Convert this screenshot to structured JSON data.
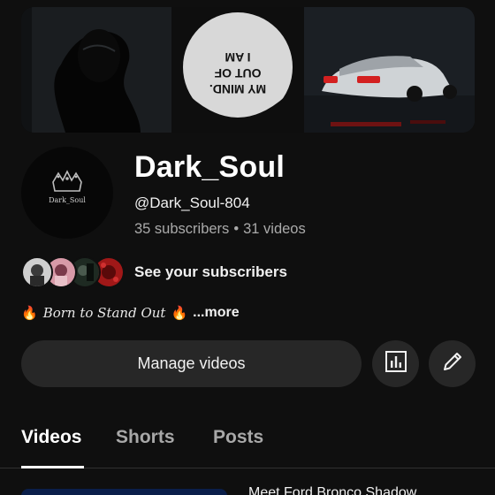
{
  "banner": {
    "center_text": [
      "I AM",
      "OUT OF",
      "MY MIND."
    ]
  },
  "channel": {
    "avatar_text": "Dark_Soul",
    "name": "Dark_Soul",
    "handle": "@Dark_Soul-804",
    "subscribers": "35 subscribers",
    "separator": "•",
    "videos": "31 videos"
  },
  "subscribers_row": {
    "label": "See your subscribers"
  },
  "bio": {
    "prefix_icon": "🔥",
    "text": "Born to Stand Out",
    "suffix_icon": "🔥",
    "more_label": "...more"
  },
  "actions": {
    "manage_label": "Manage videos",
    "analytics_icon": "bar-chart-icon",
    "edit_icon": "pencil-icon"
  },
  "tabs": [
    {
      "label": "Videos",
      "active": true
    },
    {
      "label": "Shorts",
      "active": false
    },
    {
      "label": "Posts",
      "active": false
    }
  ],
  "next_video": {
    "title": "Meet Ford Bronco Shadow..."
  },
  "colors": {
    "background": "#0f0f0f",
    "button": "#272727",
    "secondary_text": "#aaaaaa"
  }
}
